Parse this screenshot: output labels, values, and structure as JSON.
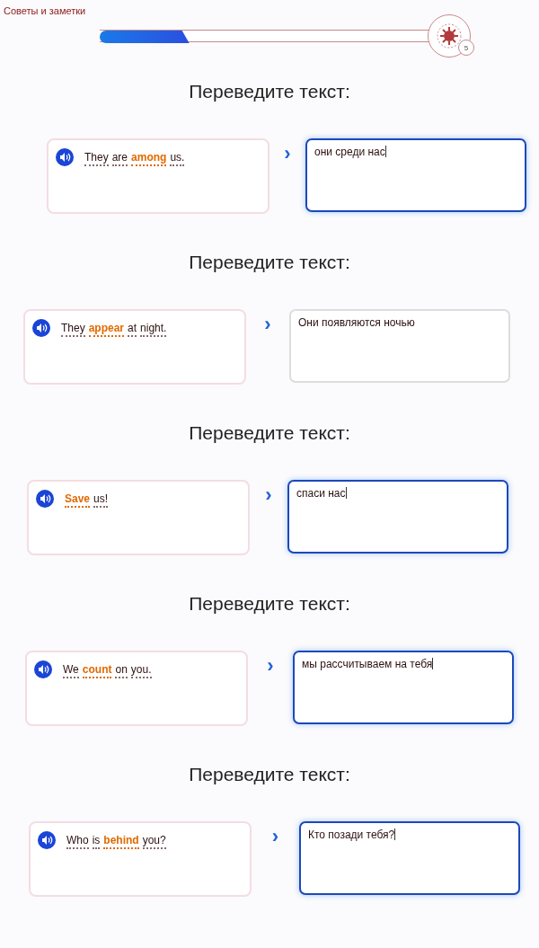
{
  "header": {
    "title": "Советы и заметки",
    "progress": {
      "level": 0.27,
      "count": "5"
    }
  },
  "exercises": [
    {
      "prompt": "Переведите текст:",
      "words": [
        {
          "text": "They",
          "highlighted": false
        },
        {
          "text": "are",
          "highlighted": false
        },
        {
          "text": "among",
          "highlighted": true
        },
        {
          "text": "us.",
          "highlighted": false
        }
      ],
      "arrow": "›",
      "answer": "они среди нас",
      "focused": true
    },
    {
      "prompt": "Переведите текст:",
      "words": [
        {
          "text": "They",
          "highlighted": false
        },
        {
          "text": "appear",
          "highlighted": true
        },
        {
          "text": "at",
          "highlighted": false
        },
        {
          "text": "night.",
          "highlighted": false
        }
      ],
      "arrow": "›",
      "answer": "Они появляются ночью",
      "focused": false
    },
    {
      "prompt": "Переведите текст:",
      "words": [
        {
          "text": "Save",
          "highlighted": true
        },
        {
          "text": "us!",
          "highlighted": false
        }
      ],
      "arrow": "›",
      "answer": "спаси нас",
      "focused": true
    },
    {
      "prompt": "Переведите текст:",
      "words": [
        {
          "text": "We",
          "highlighted": false
        },
        {
          "text": "count",
          "highlighted": true
        },
        {
          "text": "on",
          "highlighted": false
        },
        {
          "text": "you.",
          "highlighted": false
        }
      ],
      "arrow": "›",
      "answer": "мы рассчитываем на тебя",
      "focused": true
    },
    {
      "prompt": "Переведите текст:",
      "words": [
        {
          "text": "Who",
          "highlighted": false
        },
        {
          "text": "is",
          "highlighted": false
        },
        {
          "text": "behind",
          "highlighted": true
        },
        {
          "text": "you?",
          "highlighted": false
        }
      ],
      "arrow": "›",
      "answer": "Кто позади тебя?",
      "focused": true
    }
  ]
}
